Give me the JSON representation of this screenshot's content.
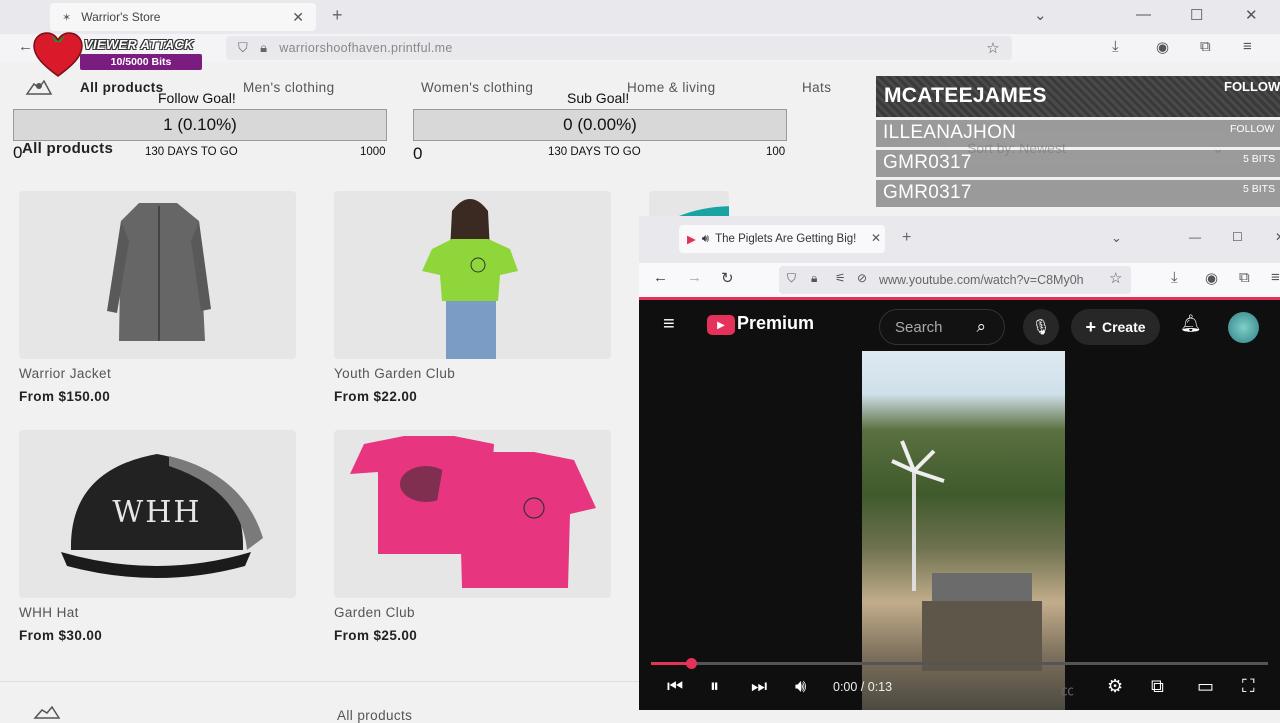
{
  "browser": {
    "tab_title": "Warrior's Store",
    "url": "warriorshoofhaven.printful.me"
  },
  "viewer_attack": {
    "title": "VIEWER ATTACK",
    "progress_text": "10/5000 Bits"
  },
  "store": {
    "nav": [
      "All products",
      "Men's clothing",
      "Women's clothing",
      "Home & living",
      "Hats"
    ],
    "heading": "All products",
    "sort_label": "Sort by: Newest",
    "footer_link": "All products",
    "products": [
      {
        "name": "Warrior Jacket",
        "price": "From $150.00"
      },
      {
        "name": "Youth Garden Club",
        "price": "From $22.00"
      },
      {
        "name": "WHH Hat",
        "price": "From $30.00"
      },
      {
        "name": "Garden Club",
        "price": "From $25.00"
      }
    ],
    "hat_text": "WHH"
  },
  "goals": {
    "follow": {
      "label": "Follow Goal!",
      "value": "1 (0.10%)",
      "min": "0",
      "days": "130 DAYS TO GO",
      "max": "1000"
    },
    "sub": {
      "label": "Sub Goal!",
      "value": "0 (0.00%)",
      "min": "0",
      "days": "130 DAYS TO GO",
      "max": "100"
    }
  },
  "alerts": {
    "main": {
      "name": "MCATEEJAMES",
      "tag": "FOLLOW"
    },
    "rows": [
      {
        "name": "ILLEANAJHON",
        "tag": "FOLLOW"
      },
      {
        "name": "GMR0317",
        "tag": "5 BITS"
      },
      {
        "name": "GMR0317",
        "tag": "5 BITS"
      }
    ]
  },
  "youtube": {
    "tab_title": "The Piglets Are Getting Big!",
    "url": "www.youtube.com/watch?v=C8My0h",
    "brand": "Premium",
    "search_placeholder": "Search",
    "create_label": "Create",
    "time": "0:00 / 0:13",
    "progress_fraction": 0.0,
    "accent": "#e4325a"
  }
}
